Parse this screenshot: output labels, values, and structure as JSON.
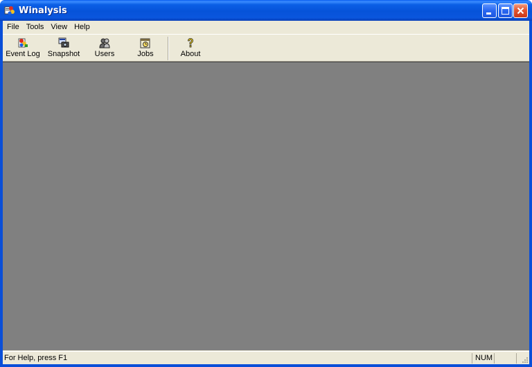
{
  "window": {
    "title": "Winalysis",
    "app_icon": "winalysis-app-icon",
    "controls": [
      "minimize-icon",
      "maximize-icon",
      "close-icon"
    ]
  },
  "menubar": {
    "items": [
      {
        "label": "File"
      },
      {
        "label": "Tools"
      },
      {
        "label": "View"
      },
      {
        "label": "Help"
      }
    ]
  },
  "toolbar": {
    "buttons": [
      {
        "label": "Event Log",
        "icon": "event-log-icon"
      },
      {
        "label": "Snapshot",
        "icon": "snapshot-icon"
      },
      {
        "label": "Users",
        "icon": "users-icon"
      },
      {
        "label": "Jobs",
        "icon": "jobs-icon"
      },
      {
        "label": "About",
        "icon": "about-icon"
      }
    ]
  },
  "statusbar": {
    "text": "For Help, press F1",
    "num": "NUM"
  },
  "colors": {
    "titlebar": "#0653d9",
    "face": "#ece9d8",
    "workspace": "#808080",
    "close_button": "#e2552f"
  }
}
